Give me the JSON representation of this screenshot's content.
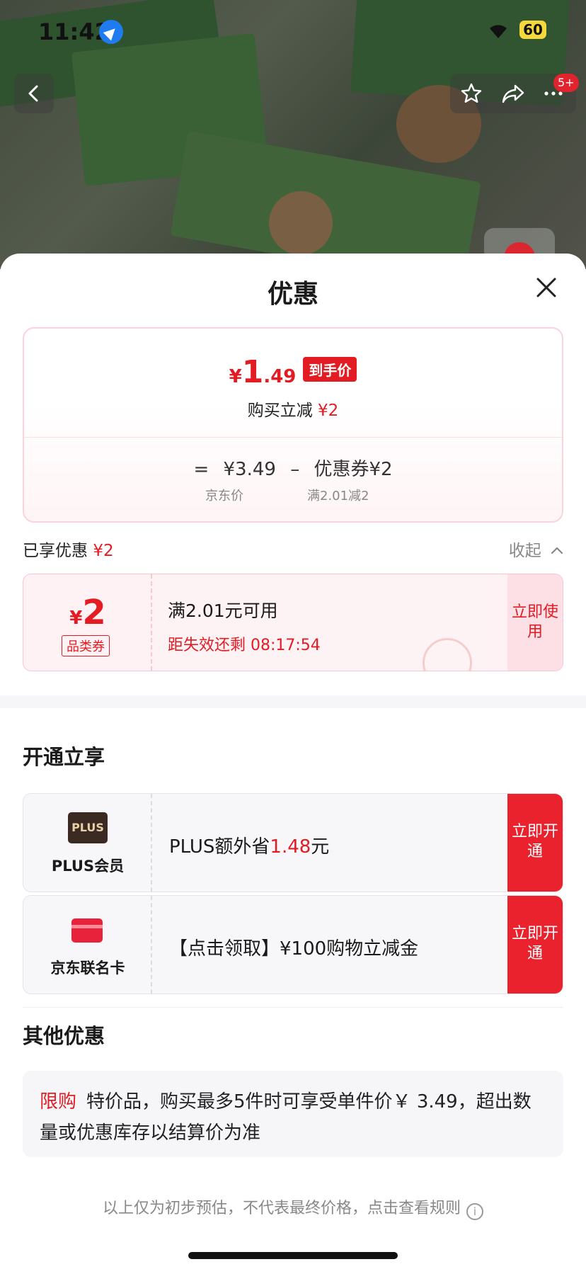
{
  "status_bar": {
    "time": "11:42",
    "battery": "60"
  },
  "nav": {
    "badge": "5+"
  },
  "sheet": {
    "title": "优惠",
    "summary": {
      "yen": "¥",
      "price_int": "1",
      "price_dec": ".49",
      "final_tag": "到手价",
      "save_label": "购买立减",
      "save_amount": "¥2",
      "formula_eq": "=",
      "jd_price": "¥3.49",
      "minus": "–",
      "coupon_part": "优惠券¥2",
      "jd_price_label": "京东价",
      "coupon_rule": "满2.01减2"
    },
    "enjoyed": {
      "label": "已享优惠",
      "amount": "¥2",
      "collapse": "收起"
    },
    "coupon": {
      "yen": "¥",
      "amount": "2",
      "type": "品类券",
      "condition": "满2.01元可用",
      "expire": "距失效还剩 08:17:54",
      "action": "立即使用"
    },
    "open_section": {
      "title": "开通立享",
      "plus": {
        "logo": "PLUS",
        "name": "PLUS会员",
        "text_prefix": "PLUS额外省",
        "amount": "1.48",
        "text_suffix": "元",
        "action": "立即开通"
      },
      "card": {
        "name": "京东联名卡",
        "text": "【点击领取】¥100购物立减金",
        "action": "立即开通"
      }
    },
    "other_section": {
      "title": "其他优惠",
      "tag": "限购",
      "text": "特价品，购买最多5件时可享受单件价￥ 3.49，超出数量或优惠库存以结算价为准"
    },
    "footer": "以上仅为初步预估，不代表最终价格，点击查看规则"
  }
}
